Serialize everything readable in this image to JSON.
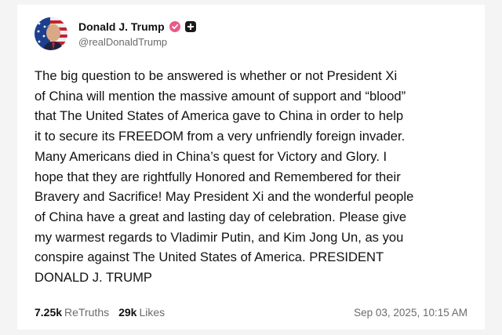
{
  "author": {
    "display_name": "Donald J. Trump",
    "handle": "@realDonaldTrump",
    "avatar_icon": "avatar-portrait",
    "verified_icon": "verified-badge-icon",
    "verified_color": "#e85b86"
  },
  "post": {
    "text": "The big question to be  answered is whether or not President Xi\nof China will mention the massive amount of  support and “blood”\nthat The United States of America gave to China in order to help\nit to secure its FREEDOM from a very unfriendly foreign invader.\nMany Americans died in China’s quest for Victory and Glory. I\nhope that they are rightfully Honored and Remembered for their\nBravery and Sacrifice! May President Xi and the wonderful people\nof China have a great and lasting day of celebration. Please give\nmy warmest regards to Vladimir Putin, and Kim Jong Un, as you\nconspire against The United States of America. PRESIDENT\nDONALD J. TRUMP"
  },
  "stats": {
    "retruths_count": "7.25k",
    "retruths_label": "ReTruths",
    "likes_count": "29k",
    "likes_label": "Likes",
    "timestamp": "Sep 03, 2025, 10:15 AM"
  }
}
